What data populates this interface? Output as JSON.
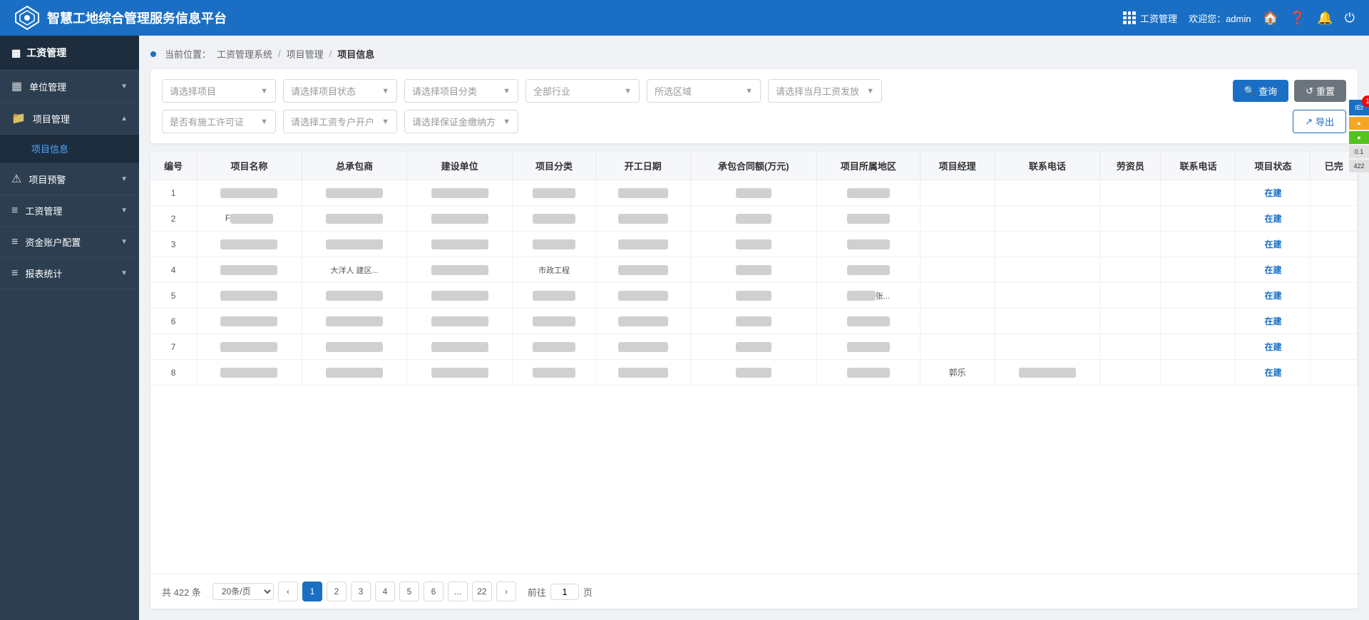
{
  "header": {
    "logo_text": "智慧工地综合管理服务信息平台",
    "module_icon_label": "工资管理",
    "welcome": "欢迎您：admin"
  },
  "sidebar": {
    "title": "工资管理",
    "items": [
      {
        "id": "unit-mgmt",
        "label": "单位管理",
        "icon": "▦",
        "has_arrow": true,
        "expanded": false
      },
      {
        "id": "project-mgmt",
        "label": "项目管理",
        "icon": "📁",
        "has_arrow": true,
        "expanded": true
      },
      {
        "id": "project-info",
        "label": "项目信息",
        "sub": true,
        "active": true
      },
      {
        "id": "project-warning",
        "label": "项目预警",
        "icon": "⚠",
        "has_arrow": true,
        "expanded": false
      },
      {
        "id": "wage-mgmt",
        "label": "工资管理",
        "icon": "💰",
        "has_arrow": true,
        "expanded": false
      },
      {
        "id": "fund-acct",
        "label": "资金账户配置",
        "icon": "🏦",
        "has_arrow": true,
        "expanded": false
      },
      {
        "id": "report-stats",
        "label": "报表统计",
        "icon": "📊",
        "has_arrow": true,
        "expanded": false
      }
    ]
  },
  "breadcrumb": {
    "prefix": "当前位置：",
    "items": [
      "工资管理系统",
      "项目管理",
      "项目信息"
    ]
  },
  "filters": {
    "row1": [
      {
        "id": "select-project",
        "placeholder": "请选择项目"
      },
      {
        "id": "select-status",
        "placeholder": "请选择项目状态"
      },
      {
        "id": "select-category",
        "placeholder": "请选择项目分类"
      },
      {
        "id": "select-industry",
        "placeholder": "全部行业"
      },
      {
        "id": "select-area",
        "placeholder": "所选区域"
      },
      {
        "id": "select-wage-month",
        "placeholder": "请选择当月工资发放"
      }
    ],
    "row2": [
      {
        "id": "select-permit",
        "placeholder": "是否有施工许可证"
      },
      {
        "id": "select-wage-acct",
        "placeholder": "请选择工资专户开户"
      },
      {
        "id": "select-deposit",
        "placeholder": "请选择保证金缴纳方"
      }
    ],
    "query_btn": "查询",
    "reset_btn": "重置",
    "export_btn": "导出"
  },
  "table": {
    "columns": [
      "编号",
      "项目名称",
      "总承包商",
      "建设单位",
      "项目分类",
      "开工日期",
      "承包合同额(万元)",
      "项目所属地区",
      "项目经理",
      "联系电话",
      "劳资员",
      "联系电话",
      "项目状态",
      "已完"
    ],
    "rows": [
      {
        "id": 1,
        "status": "在建"
      },
      {
        "id": 2,
        "name_hint": "F",
        "status": "在建"
      },
      {
        "id": 3,
        "status": "在建"
      },
      {
        "id": 4,
        "contractor_hint": "大洋人 建区...",
        "category_hint": "市政工程",
        "status": "在建"
      },
      {
        "id": 5,
        "area_hint": "张...",
        "status": "在建"
      },
      {
        "id": 6,
        "status": "在建"
      },
      {
        "id": 7,
        "status": "在建"
      },
      {
        "id": 8,
        "manager": "郭乐",
        "status": "在建"
      }
    ]
  },
  "pagination": {
    "total": "共 422 条",
    "page_size": "20条/页",
    "current": 1,
    "pages": [
      1,
      2,
      3,
      4,
      5,
      6,
      "...",
      22
    ],
    "goto_label": "前往",
    "goto_value": "1",
    "page_label": "页"
  },
  "right_panel": {
    "badge": "1",
    "items": [
      "0,1",
      "422"
    ]
  }
}
